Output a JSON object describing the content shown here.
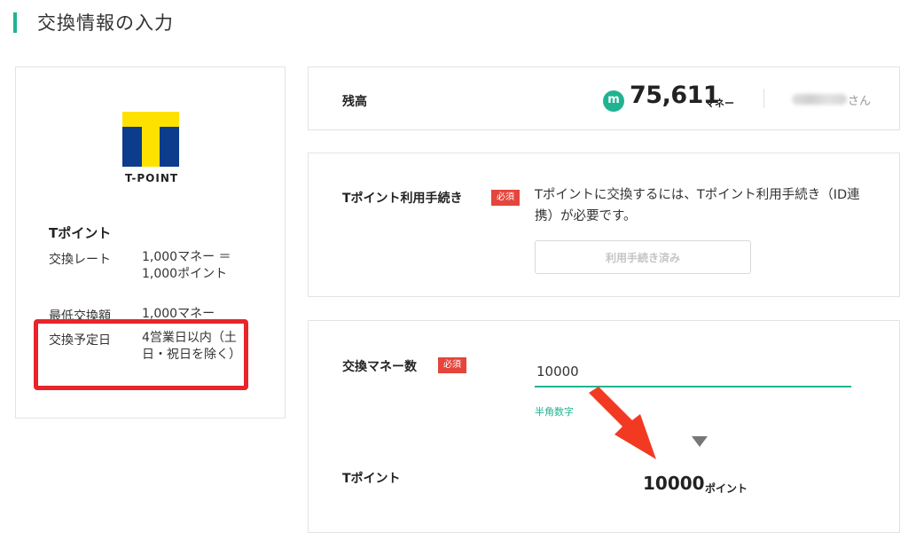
{
  "page": {
    "title": "交換情報の入力"
  },
  "partner": {
    "logo_text": "T-POINT",
    "name": "Tポイント",
    "rows": [
      {
        "label": "交換レート",
        "value": "1,000マネー ＝ 1,000ポイント"
      },
      {
        "label": "最低交換額",
        "value": "1,000マネー"
      },
      {
        "label": "交換予定日",
        "value": "4営業日以内（土日・祝日を除く）"
      }
    ]
  },
  "balance": {
    "label": "残高",
    "icon_letter": "m",
    "value": "75,611",
    "unit": "マネー",
    "user_suffix": "さん"
  },
  "procedure": {
    "label": "Tポイント利用手続き",
    "required": "必須",
    "description": "Tポイントに交換するには、Tポイント利用手続き（ID連携）が必要です。",
    "button_label": "利用手続き済み"
  },
  "exchange": {
    "label": "交換マネー数",
    "required": "必須",
    "input_value": "10000",
    "hint": "半角数字",
    "result_label": "Tポイント",
    "result_value": "10000",
    "result_unit": "ポイント"
  },
  "colors": {
    "accent": "#20b393",
    "required_badge": "#e4453c",
    "highlight": "#e8252a",
    "logo_yellow": "#ffe100",
    "logo_blue": "#0d3c8c"
  }
}
